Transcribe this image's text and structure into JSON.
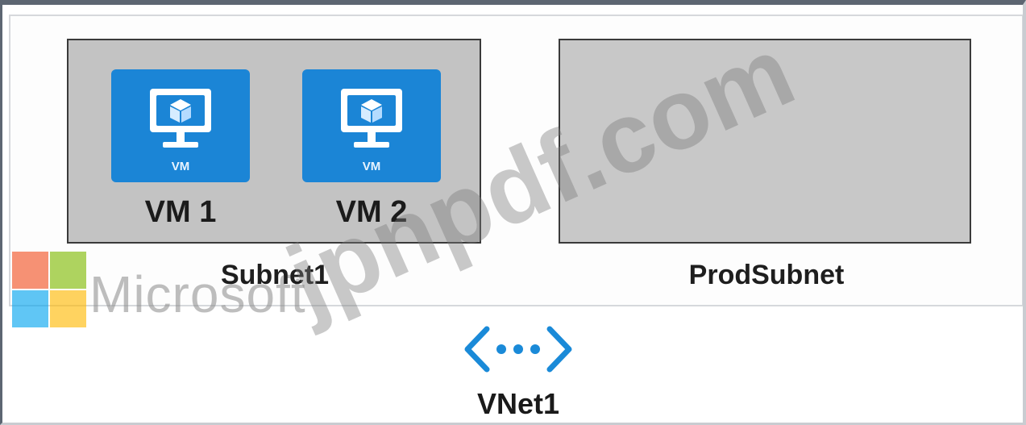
{
  "diagram": {
    "vnet_label": "VNet1",
    "subnets": [
      {
        "label": "Subnet1"
      },
      {
        "label": "ProdSubnet"
      }
    ],
    "vms": [
      {
        "label": "VM 1",
        "badge": "VM"
      },
      {
        "label": "VM 2",
        "badge": "VM"
      }
    ]
  },
  "watermarks": {
    "brand_text": "Microsoft",
    "domain_text": "jpnpdf.com"
  },
  "colors": {
    "vm_tile": "#1b85d6",
    "subnet_fill": "#c3c3c3",
    "subnet_border": "#3a3a3a",
    "vnet_icon": "#1a8ad8"
  },
  "icons": {
    "vm": "monitor-cube-icon",
    "vnet": "virtual-network-icon",
    "logo": "microsoft-logo"
  }
}
